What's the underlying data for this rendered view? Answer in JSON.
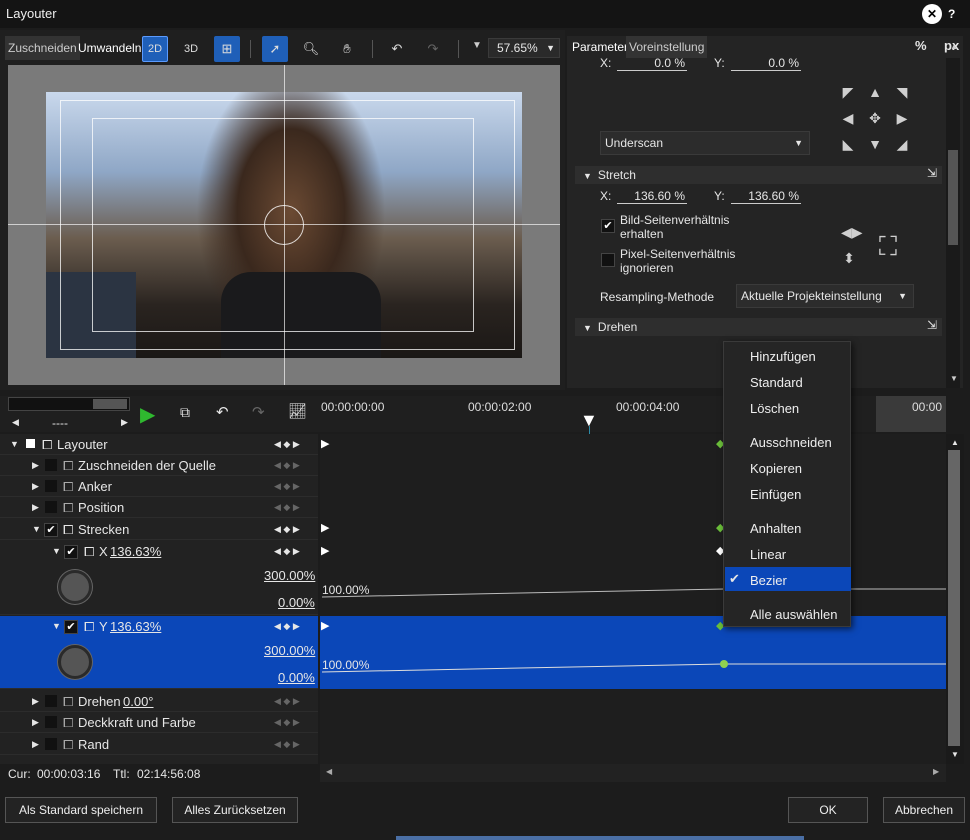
{
  "window": {
    "title": "Layouter",
    "close_icon": "close-circle-icon",
    "help_label": "?"
  },
  "toolbar": {
    "tab_crop": "Zuschneiden",
    "tab_convert": "Umwandeln",
    "btn_2d": "2D",
    "btn_3d": "3D",
    "zoom": "57.65%"
  },
  "params": {
    "tab_parameter": "Parameter",
    "tab_preset": "Voreinstellung",
    "unit_percent": "%",
    "unit_px": "px",
    "x_label": "X:",
    "x_value": "0.0 %",
    "y_label": "Y:",
    "y_value": "0.0 %",
    "underscan": "Underscan",
    "stretch_title": "Stretch",
    "stretch_x_label": "X:",
    "stretch_x": "136.60 %",
    "stretch_y_label": "Y:",
    "stretch_y": "136.60 %",
    "keep_aspect": "Bild-Seitenverhältnis erhalten",
    "keep_aspect_l1": "Bild-Seitenverhältnis",
    "keep_aspect_l2": "erhalten",
    "ignore_pixel_l1": "Pixel-Seitenverhältnis",
    "ignore_pixel_l2": "ignorieren",
    "resampling_label": "Resampling-Methode",
    "resampling_value": "Aktuelle Projekteinstellung",
    "rotate_title": "Drehen"
  },
  "timeline": {
    "ruler": [
      "00:00:00:00",
      "00:00:02:00",
      "00:00:04:00",
      "00:00"
    ],
    "dash": "----",
    "tracks": [
      {
        "label": "Layouter"
      },
      {
        "label": "Zuschneiden der Quelle"
      },
      {
        "label": "Anker"
      },
      {
        "label": "Position"
      },
      {
        "label": "Strecken"
      },
      {
        "label": "X",
        "value": "136.63%"
      },
      {
        "label": "Y",
        "value": "136.63%"
      },
      {
        "label": "Drehen",
        "value": "0.00°"
      },
      {
        "label": "Deckkraft und Farbe"
      },
      {
        "label": "Rand"
      }
    ],
    "x_max": "300.00%",
    "x_min": "0.00%",
    "x_curve": "100.00%",
    "y_max": "300.00%",
    "y_min": "0.00%",
    "y_curve": "100.00%",
    "cur_label": "Cur:",
    "cur": "00:00:03:16",
    "ttl_label": "Ttl:",
    "ttl": "02:14:56:08"
  },
  "context_menu": {
    "items": [
      "Hinzufügen",
      "Standard",
      "Löschen",
      "Ausschneiden",
      "Kopieren",
      "Einfügen",
      "Anhalten",
      "Linear",
      "Bezier",
      "Alle auswählen"
    ],
    "checked": "Bezier"
  },
  "footer": {
    "save_default": "Als Standard speichern",
    "reset_all": "Alles Zurücksetzen",
    "ok": "OK",
    "cancel": "Abbrechen"
  }
}
